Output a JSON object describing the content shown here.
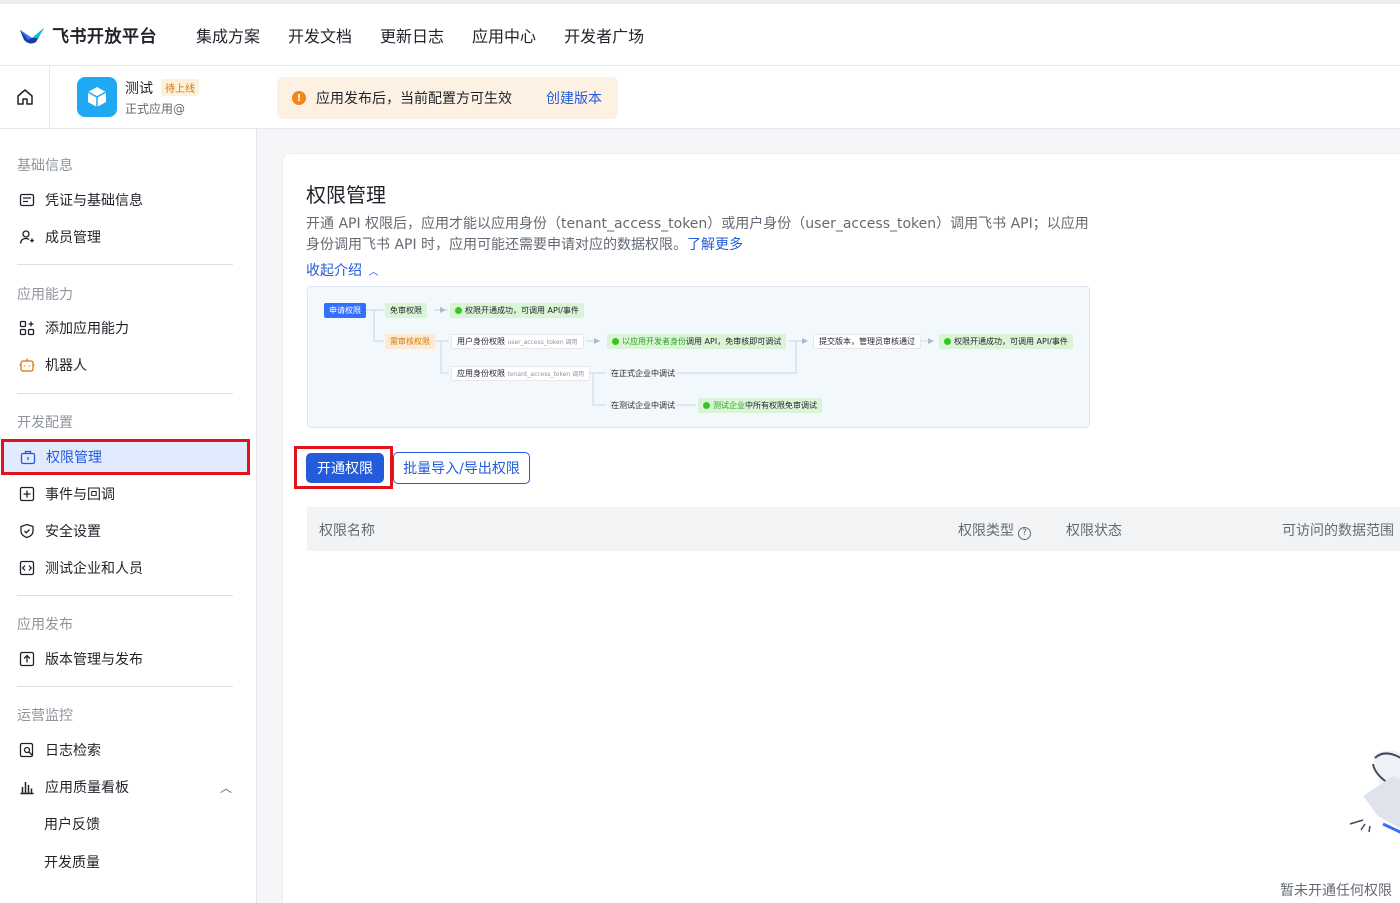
{
  "brand": {
    "name": "飞书开放平台"
  },
  "topnav": {
    "items": [
      "集成方案",
      "开发文档",
      "更新日志",
      "应用中心",
      "开发者广场"
    ]
  },
  "app": {
    "name": "测试",
    "badge": "待上线",
    "subtitle": "正式应用@"
  },
  "notice": {
    "text": "应用发布后，当前配置方可生效",
    "link": "创建版本"
  },
  "sidebar": {
    "groups": [
      "基础信息",
      "应用能力",
      "开发配置",
      "应用发布",
      "运营监控"
    ],
    "items": [
      "凭证与基础信息",
      "成员管理",
      "添加应用能力",
      "机器人",
      "权限管理",
      "事件与回调",
      "安全设置",
      "测试企业和人员",
      "版本管理与发布",
      "日志检索",
      "应用质量看板",
      "用户反馈",
      "开发质量"
    ]
  },
  "main": {
    "title": "权限管理",
    "desc": "开通 API 权限后，应用才能以应用身份（tenant_access_token）或用户身份（user_access_token）调用飞书 API；以应用身份调用飞书 API 时，应用可能还需要申请对应的数据权限。",
    "learn_more": "了解更多",
    "collapse": "收起介绍",
    "flow": {
      "apply": "申请权限",
      "no_review": "免审权限",
      "success1": "权限开通成功，可调用 API/事件",
      "need_review": "需审核权限",
      "user_perm": "用户身份权限",
      "user_token": "user_access_token 调用",
      "dev_identity": "以应用开发者身份",
      "dev_call": "调用 API，免审核即可调试",
      "submit": "提交版本，管理员审核通过",
      "success2": "权限开通成功，可调用 API/事件",
      "app_perm": "应用身份权限",
      "tenant_token": "tenant_access_token 调用",
      "formal_test": "在正式企业中调试",
      "test_ent": "在测试企业中调试",
      "test_ent_green": "测试企业",
      "test_ent_all": "中所有权限免审调试"
    },
    "btn_open": "开通权限",
    "btn_batch": "批量导入/导出权限",
    "table": {
      "headers": [
        "权限名称",
        "权限类型",
        "权限状态",
        "可访问的数据范围"
      ]
    },
    "empty": "暂未开通任何权限"
  }
}
